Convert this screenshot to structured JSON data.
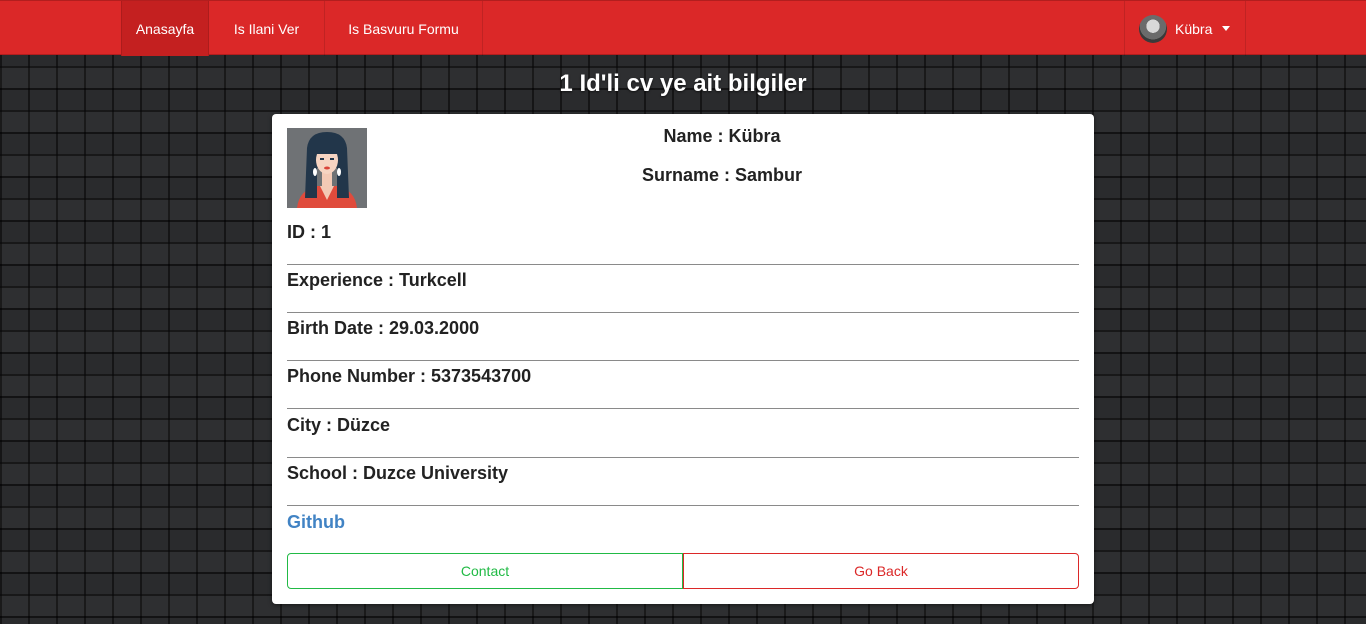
{
  "navbar": {
    "items": [
      {
        "label": "Anasayfa",
        "active": true
      },
      {
        "label": "Is Ilani Ver",
        "active": false
      },
      {
        "label": "Is Basvuru Formu",
        "active": false
      }
    ],
    "user": {
      "name": "Kübra",
      "avatar_icon": "user-avatar"
    }
  },
  "page": {
    "title": "1 Id'li cv ye ait bilgiler"
  },
  "cv": {
    "photo_icon": "woman-avatar-illustration",
    "name": "Name : Kübra",
    "surname": "Surname : Sambur",
    "id": "ID : 1",
    "experience": "Experience : Turkcell",
    "birth_date": "Birth Date : 29.03.2000",
    "phone": "Phone Number : 5373543700",
    "city": "City : Düzce",
    "school": "School : Duzce University",
    "github_label": "Github"
  },
  "buttons": {
    "contact": "Contact",
    "go_back": "Go Back"
  },
  "colors": {
    "navbar": "#db2828",
    "contact": "#21ba45",
    "go_back": "#db2828",
    "link": "#4183c4"
  }
}
